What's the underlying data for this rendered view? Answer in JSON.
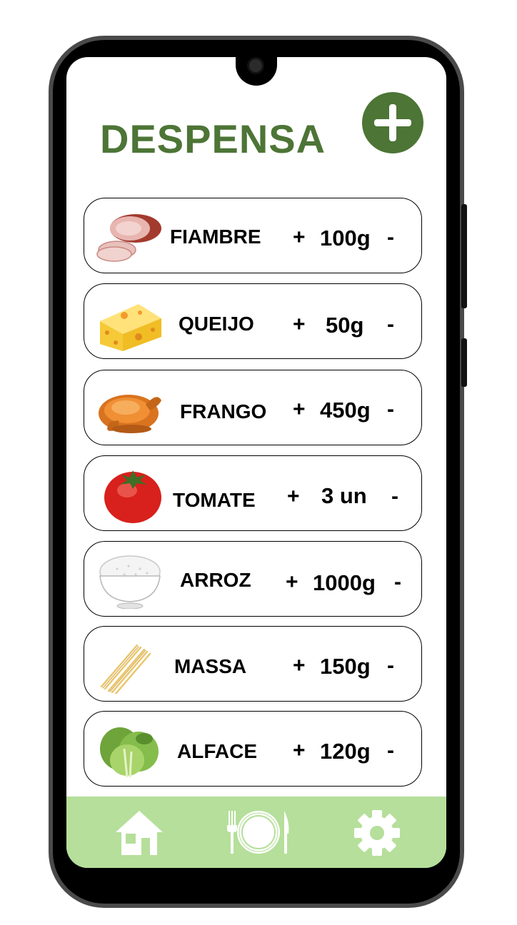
{
  "header": {
    "title": "DESPENSA",
    "add_icon": "plus-icon"
  },
  "items": [
    {
      "name": "FIAMBRE",
      "quantity": "100g",
      "plus": "+",
      "minus": "-",
      "icon": "ham-icon"
    },
    {
      "name": "QUEIJO",
      "quantity": "50g",
      "plus": "+",
      "minus": "-",
      "icon": "cheese-icon"
    },
    {
      "name": "FRANGO",
      "quantity": "450g",
      "plus": "+",
      "minus": "-",
      "icon": "chicken-icon"
    },
    {
      "name": "TOMATE",
      "quantity": "3 un",
      "plus": "+",
      "minus": "-",
      "icon": "tomato-icon"
    },
    {
      "name": "ARROZ",
      "quantity": "1000g",
      "plus": "+",
      "minus": "-",
      "icon": "rice-bowl-icon"
    },
    {
      "name": "MASSA",
      "quantity": "150g",
      "plus": "+",
      "minus": "-",
      "icon": "pasta-icon"
    },
    {
      "name": "ALFACE",
      "quantity": "120g",
      "plus": "+",
      "minus": "-",
      "icon": "lettuce-icon"
    }
  ],
  "bottom_nav": [
    {
      "icon": "home-icon"
    },
    {
      "icon": "plate-cutlery-icon"
    },
    {
      "icon": "gear-icon"
    }
  ],
  "colors": {
    "accent": "#4d7536",
    "nav_background": "#b5df9a"
  }
}
